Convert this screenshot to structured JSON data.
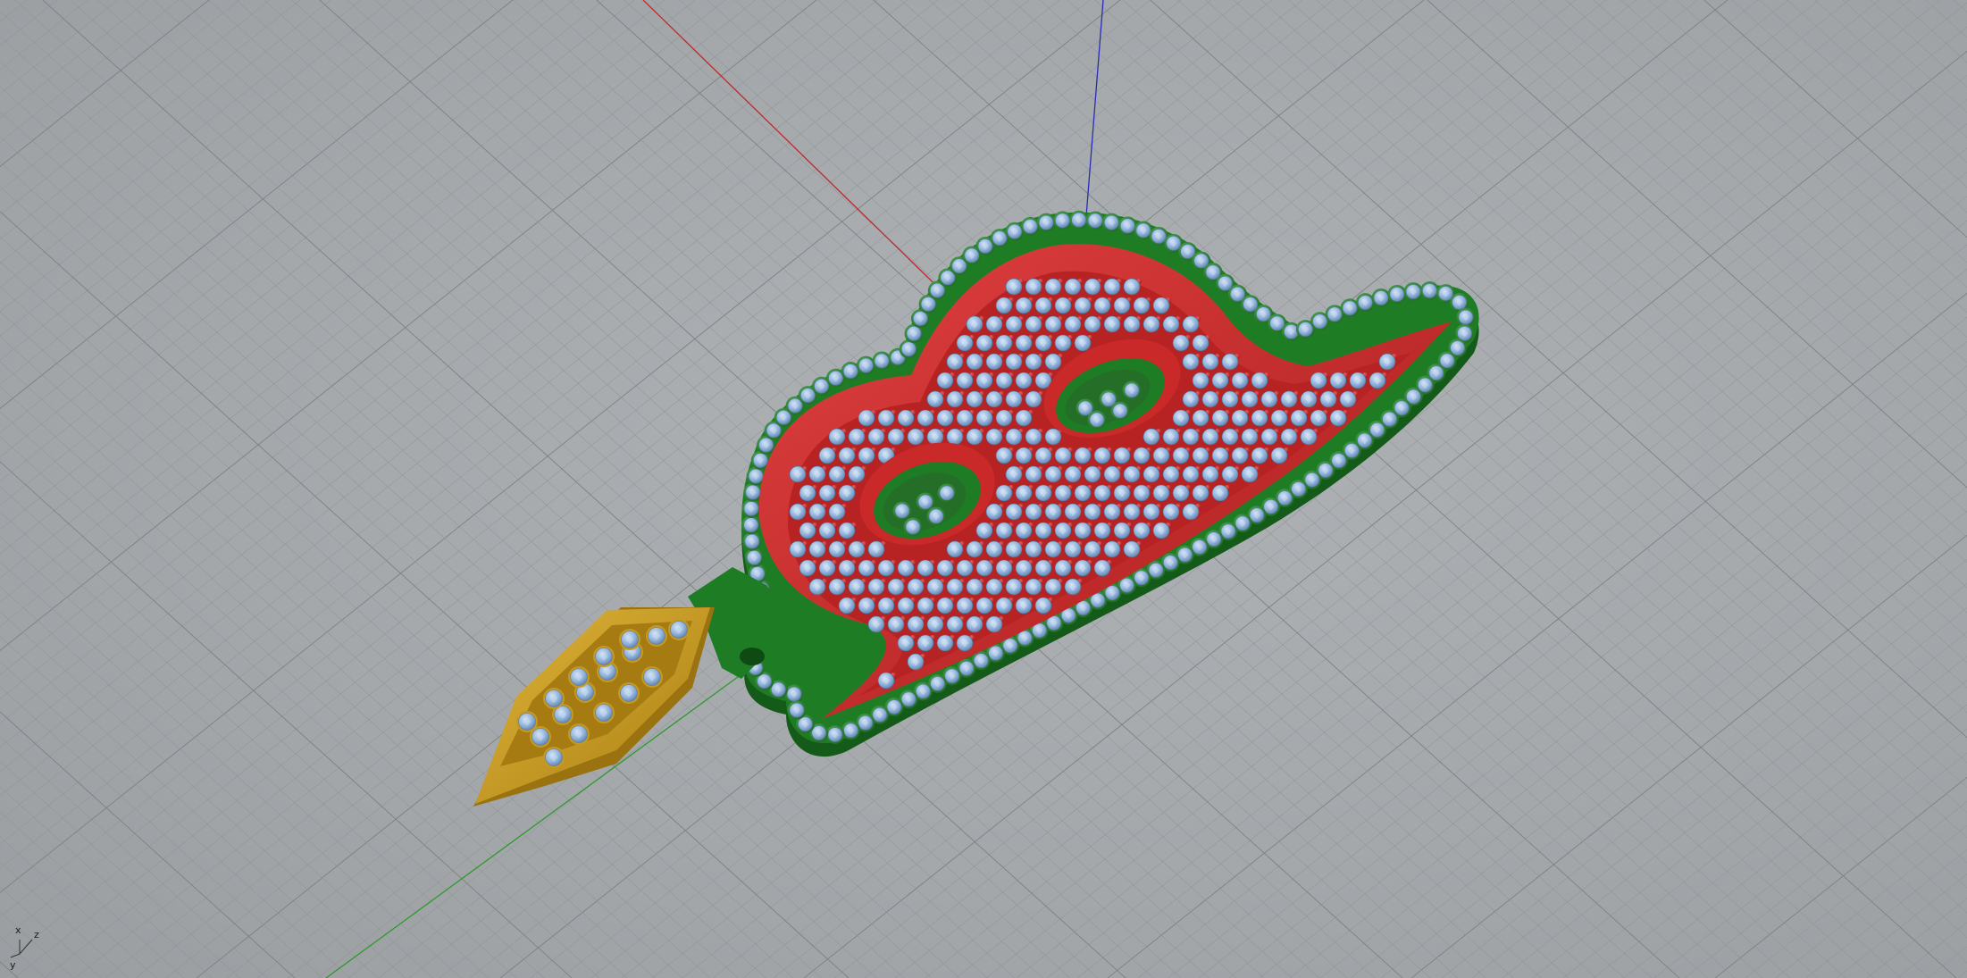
{
  "viewport": {
    "grid_color": "#8f9396",
    "major_grid_color": "#7c8083",
    "background": "#a4a8ab"
  },
  "axes": {
    "x_color": "#c0282a",
    "y_color": "#2e9a2e",
    "z_color": "#2b2bb0"
  },
  "model": {
    "body_color": "#1e7d24",
    "letter_color": "#cf2a2a",
    "bail_color": "#caa022",
    "stone_color": "#8fb1da",
    "prong_color": "#2f8f34"
  },
  "gizmo": {
    "x_label": "x",
    "y_label": "y",
    "z_label": "z"
  }
}
